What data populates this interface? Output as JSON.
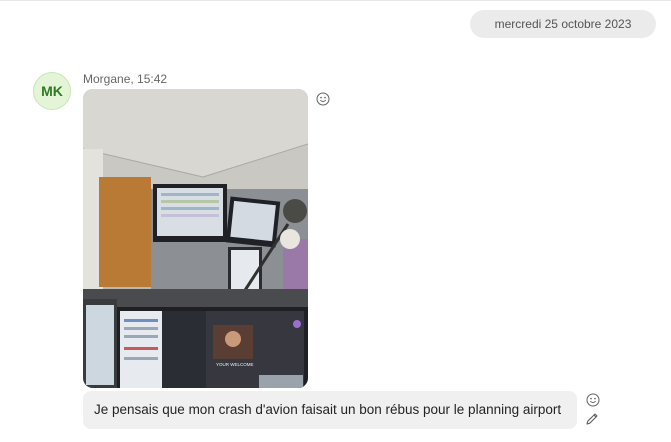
{
  "chat": {
    "date_separator": "mercredi 25 octobre 2023",
    "messages": [
      {
        "avatar_initials": "MK",
        "sender": "Morgane",
        "time": "15:42",
        "sender_line": "Morgane, 15:42",
        "attachment": {
          "type": "photo",
          "text": "YOUR WELCOME"
        },
        "text": "Je pensais que mon crash d'avion faisait un bon rébus pour le planning airport"
      }
    ]
  },
  "icons": {
    "reaction": "smiley-icon",
    "edit": "pencil-icon"
  },
  "colors": {
    "avatar_bg": "#e3f5d6",
    "avatar_text": "#2d7a23",
    "bubble_bg": "#f0f0f0",
    "date_pill_bg": "#ebebeb"
  }
}
